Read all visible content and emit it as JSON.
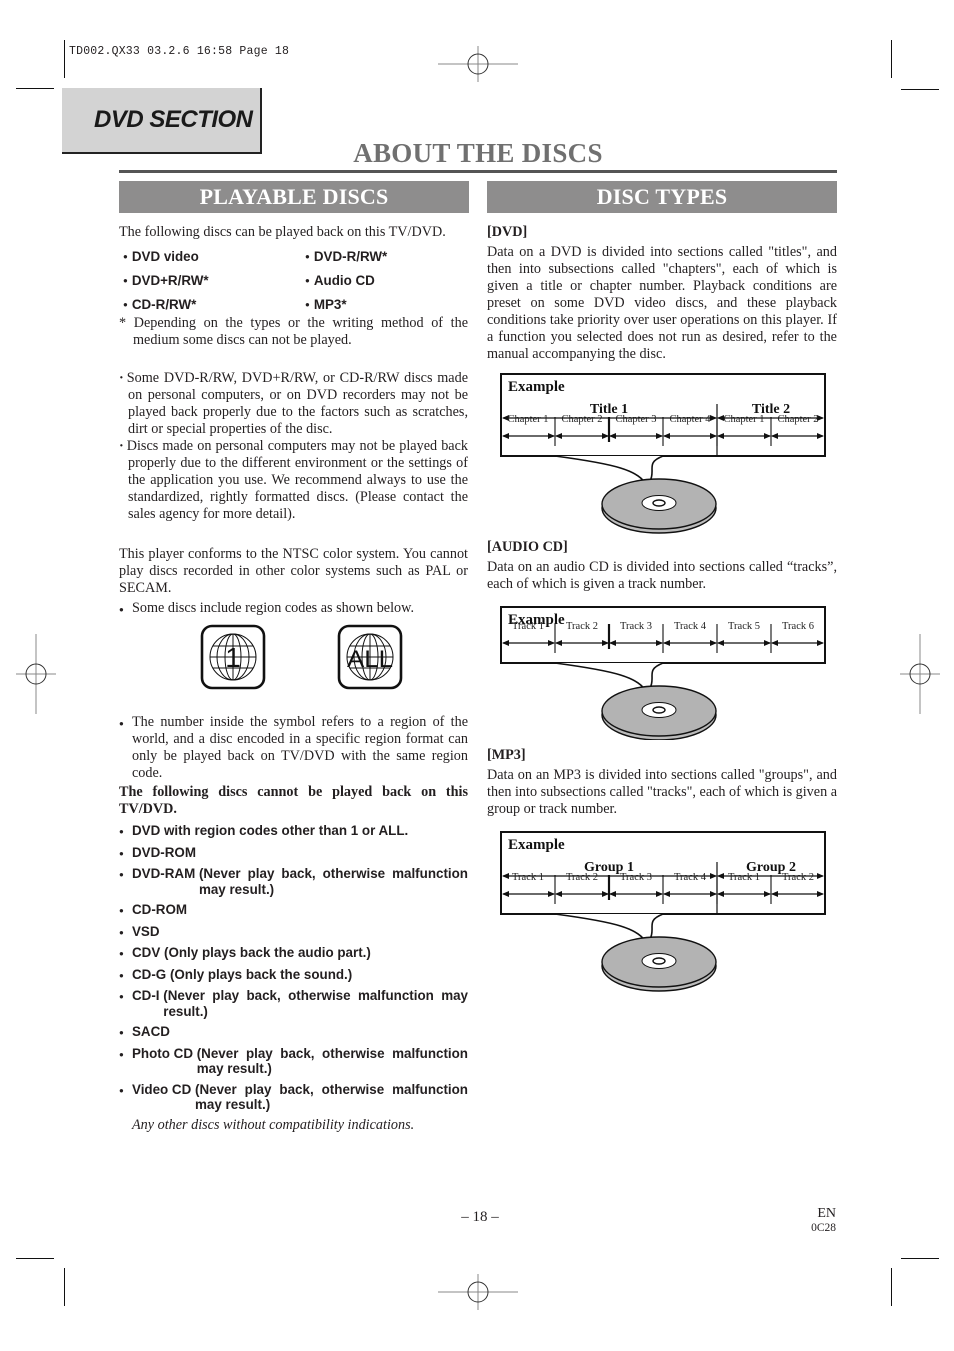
{
  "print_header": "TD002.QX33   03.2.6   16:58   Page 18",
  "section_tab": "DVD SECTION",
  "page_title": "ABOUT THE DISCS",
  "left": {
    "heading": "PLAYABLE DISCS",
    "intro": "The following discs can be played back on this TV/DVD.",
    "playable": [
      "DVD video",
      "DVD-R/RW*",
      "DVD+R/RW*",
      "Audio CD",
      "CD-R/RW*",
      "MP3*"
    ],
    "footnote": "* Depending on the types or the writing method of the medium some discs can not be played.",
    "notes": [
      "Some DVD-R/RW, DVD+R/RW, or CD-R/RW discs made on personal computers, or on DVD recorders may not be played back properly due to the factors such as scratches, dirt or special properties of the disc.",
      "Discs made on personal computers may not be played back properly due to the different environment or the settings of the application you use. We recommend always to use the standardized, rightly formatted discs. (Please contact the sales agency for more detail)."
    ],
    "ntsc": "This player conforms to the NTSC color system. You cannot play discs recorded in other color systems such as PAL or SECAM.",
    "region_intro": "Some discs include region codes as shown below.",
    "region_icons": [
      {
        "icon": "globe-region-icon",
        "label": "1"
      },
      {
        "icon": "globe-region-icon",
        "label": "ALL"
      }
    ],
    "region_note": "The number inside the symbol refers to a region of the world, and a disc encoded in a specific region format can only be played back on TV/DVD with the same region code.",
    "not_playable_heading": "The following discs cannot be played back on this TV/DVD.",
    "not_playable": [
      {
        "name": "DVD with region codes other than 1 or ALL.",
        "desc": ""
      },
      {
        "name": "DVD-ROM",
        "desc": ""
      },
      {
        "name": "DVD-RAM ",
        "desc": "(Never play back, otherwise malfunction may result.)"
      },
      {
        "name": "CD-ROM",
        "desc": ""
      },
      {
        "name": "VSD",
        "desc": ""
      },
      {
        "name": "CDV ",
        "desc": "(Only plays back the audio part.)"
      },
      {
        "name": "CD-G ",
        "desc": "(Only plays back the sound.)"
      },
      {
        "name": "CD-I ",
        "desc": "(Never play back, otherwise malfunction may result.)"
      },
      {
        "name": "SACD",
        "desc": ""
      },
      {
        "name": "Photo CD ",
        "desc": "(Never play back, otherwise malfunction may result.)"
      },
      {
        "name": "Video CD ",
        "desc": "(Never play back, otherwise malfunction may result.)"
      }
    ],
    "closing": "Any other discs without compatibility indications."
  },
  "right": {
    "heading": "DISC TYPES",
    "dvd": {
      "label": "[DVD]",
      "text": "Data on a DVD is divided into sections called \"titles\", and then into subsections called \"chapters\", each of which is given a title or chapter number. Playback conditions are preset on some DVD video discs, and these playback conditions take priority over user operations on this player. If a function you selected does not run as desired, refer to the manual accompanying the disc.",
      "example_label": "Example",
      "groups": [
        "Title 1",
        "Title 2"
      ],
      "items": [
        "Chapter 1",
        "Chapter 2",
        "Chapter 3",
        "Chapter 4",
        "Chapter 1",
        "Chapter 2"
      ]
    },
    "audio_cd": {
      "label": "[AUDIO CD]",
      "text": "Data on an audio CD is divided into sections called “tracks”, each of which is given a track number.",
      "example_label": "Example",
      "items": [
        "Track 1",
        "Track 2",
        "Track 3",
        "Track 4",
        "Track 5",
        "Track 6"
      ]
    },
    "mp3": {
      "label": "[MP3]",
      "text": "Data on an MP3 is divided into sections called \"groups\", and then into subsections called \"tracks\", each of which is given a group or track number.",
      "example_label": "Example",
      "groups": [
        "Group 1",
        "Group 2"
      ],
      "items": [
        "Track 1",
        "Track 2",
        "Track 3",
        "Track 4",
        "Track 1",
        "Track 2"
      ]
    }
  },
  "footer": {
    "page_number": "– 18 –",
    "lang": "EN",
    "code": "0C28"
  }
}
